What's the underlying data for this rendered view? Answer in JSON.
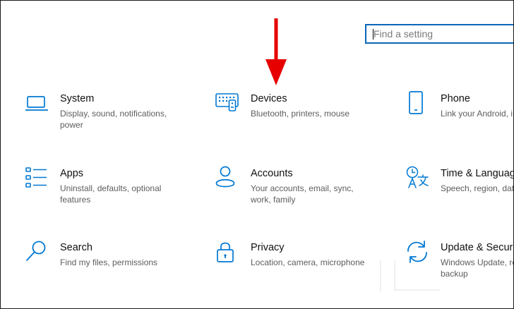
{
  "search": {
    "placeholder": "Find a setting"
  },
  "tiles": [
    {
      "title": "System",
      "desc": "Display, sound, notifications, power"
    },
    {
      "title": "Devices",
      "desc": "Bluetooth, printers, mouse"
    },
    {
      "title": "Phone",
      "desc": "Link your Android, iPhone"
    },
    {
      "title": "Apps",
      "desc": "Uninstall, defaults, optional features"
    },
    {
      "title": "Accounts",
      "desc": "Your accounts, email, sync, work, family"
    },
    {
      "title": "Time & Language",
      "desc": "Speech, region, date"
    },
    {
      "title": "Search",
      "desc": "Find my files, permissions"
    },
    {
      "title": "Privacy",
      "desc": "Location, camera, microphone"
    },
    {
      "title": "Update & Security",
      "desc": "Windows Update, recovery, backup"
    }
  ],
  "colors": {
    "accent": "#0078d4",
    "annotation_arrow": "#e60000"
  },
  "icons": [
    "laptop-icon",
    "keyboard-icon",
    "phone-icon",
    "apps-list-icon",
    "person-icon",
    "time-language-icon",
    "magnifier-icon",
    "lock-icon",
    "sync-icon"
  ]
}
